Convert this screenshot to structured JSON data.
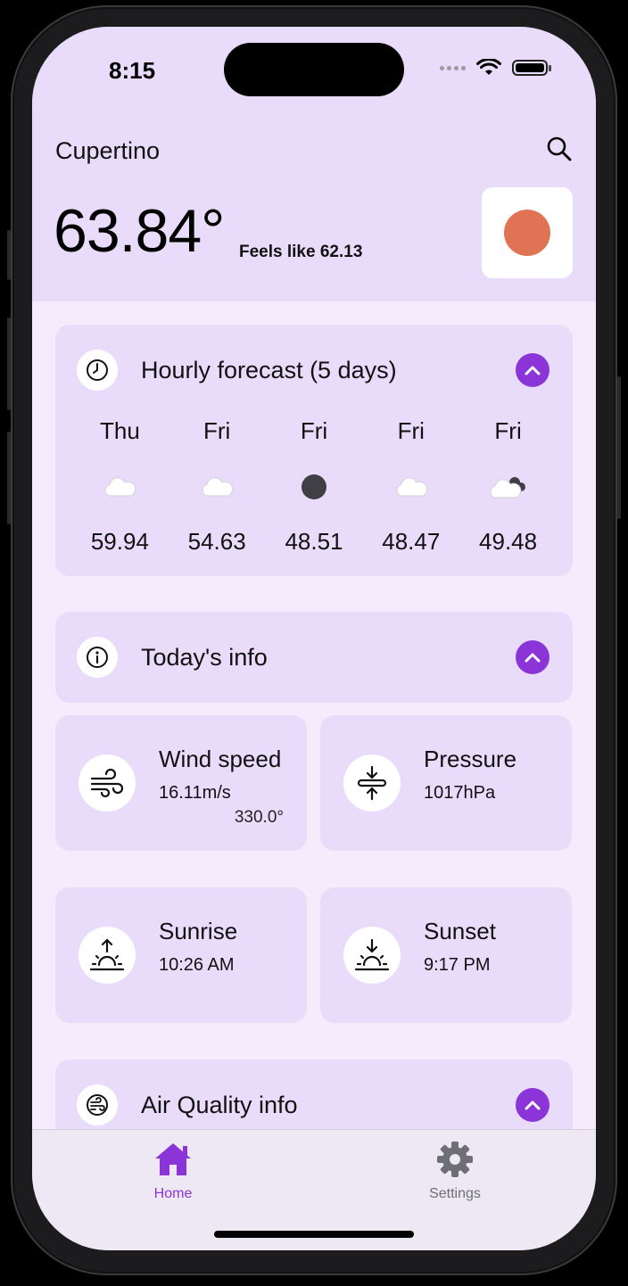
{
  "status": {
    "time": "8:15"
  },
  "header": {
    "city": "Cupertino",
    "temperature": "63.84°",
    "feels_like": "Feels like 62.13"
  },
  "hourly": {
    "title": "Hourly forecast (5 days)",
    "items": [
      {
        "day": "Thu",
        "icon": "cloud-icon",
        "temp": "59.94"
      },
      {
        "day": "Fri",
        "icon": "cloud-icon",
        "temp": "54.63"
      },
      {
        "day": "Fri",
        "icon": "moon-icon",
        "temp": "48.51"
      },
      {
        "day": "Fri",
        "icon": "cloud-icon",
        "temp": "48.47"
      },
      {
        "day": "Fri",
        "icon": "cloud-moon-icon",
        "temp": "49.48"
      }
    ]
  },
  "today": {
    "title": "Today's info",
    "wind": {
      "label": "Wind speed",
      "value": "16.11m/s",
      "direction": "330.0°"
    },
    "pressure": {
      "label": "Pressure",
      "value": "1017hPa"
    },
    "sunrise": {
      "label": "Sunrise",
      "value": "10:26 AM"
    },
    "sunset": {
      "label": "Sunset",
      "value": "9:17 PM"
    }
  },
  "air": {
    "title": "Air Quality info"
  },
  "tabs": [
    {
      "label": "Home",
      "active": true
    },
    {
      "label": "Settings",
      "active": false
    }
  ],
  "colors": {
    "accent": "#8b35d9",
    "sun": "#e07353",
    "card": "#e8dcfa",
    "background": "#f4ebfc",
    "inactive_tab": "#6e6e76"
  }
}
